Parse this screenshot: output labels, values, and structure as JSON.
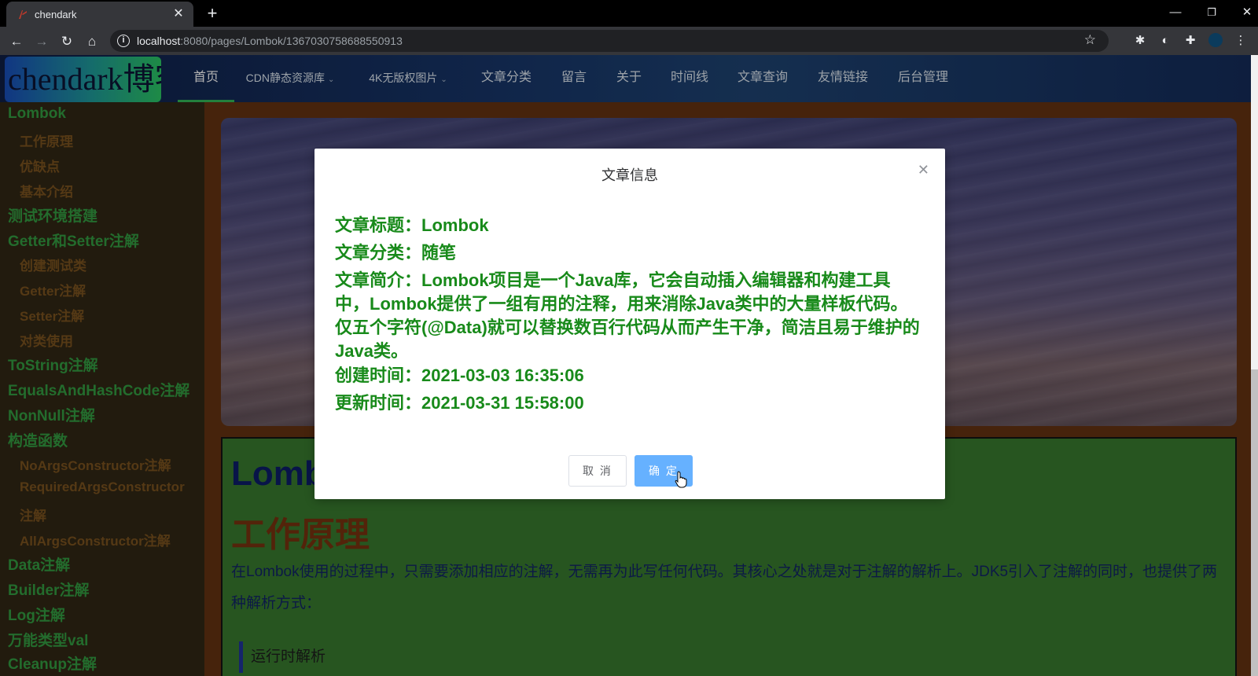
{
  "browser": {
    "tab_title": "chendark",
    "url_host": "localhost",
    "url_rest": ":8080/pages/Lombok/1367030758688550913"
  },
  "header": {
    "logo_text": "chendark博客",
    "menu": [
      {
        "label": "首页",
        "active": true
      },
      {
        "label": "CDN静态资源库",
        "dropdown": true
      },
      {
        "label": "4K无版权图片",
        "dropdown": true
      },
      {
        "label": "文章分类"
      },
      {
        "label": "留言"
      },
      {
        "label": "关于"
      },
      {
        "label": "时间线"
      },
      {
        "label": "文章查询"
      },
      {
        "label": "友情链接"
      },
      {
        "label": "后台管理"
      }
    ]
  },
  "toc": [
    {
      "label": "Lombok",
      "level": 1
    },
    {
      "label": "工作原理",
      "level": 2
    },
    {
      "label": "优缺点",
      "level": 2
    },
    {
      "label": "基本介绍",
      "level": 2
    },
    {
      "label": "测试环境搭建",
      "level": 1
    },
    {
      "label": "Getter和Setter注解",
      "level": 1
    },
    {
      "label": "创建测试类",
      "level": 2
    },
    {
      "label": "Getter注解",
      "level": 2
    },
    {
      "label": "Setter注解",
      "level": 2
    },
    {
      "label": "对类使用",
      "level": 2
    },
    {
      "label": "ToString注解",
      "level": 1
    },
    {
      "label": "EqualsAndHashCode注解",
      "level": 1
    },
    {
      "label": "NonNull注解",
      "level": 1
    },
    {
      "label": "构造函数",
      "level": 1
    },
    {
      "label": "NoArgsConstructor注解",
      "level": 2
    },
    {
      "label": "RequiredArgsConstructor",
      "level": 2
    },
    {
      "label": "注解",
      "level": 2
    },
    {
      "label": "AllArgsConstructor注解",
      "level": 2
    },
    {
      "label": "Data注解",
      "level": 1
    },
    {
      "label": "Builder注解",
      "level": 1
    },
    {
      "label": "Log注解",
      "level": 1
    },
    {
      "label": "万能类型val",
      "level": 1
    },
    {
      "label": "Cleanup注解",
      "level": 1
    }
  ],
  "content": {
    "h1": "Lombok",
    "h2": "工作原理",
    "paragraph": "在Lombok使用的过程中，只需要添加相应的注解，无需再为此写任何代码。其核心之处就是对于注解的解析上。JDK5引入了注解的同时，也提供了两种解析方式：",
    "quote": "运行时解析"
  },
  "dialog": {
    "title": "文章信息",
    "article_title": "文章标题：Lombok",
    "category": "文章分类：随笔",
    "summary": "文章简介：Lombok项目是一个Java库，它会自动插入编辑器和构建工具中，Lombok提供了一组有用的注释，用来消除Java类中的大量样板代码。仅五个字符(@Data)就可以替换数百行代码从而产生干净，简洁且易于维护的Java类。",
    "created": "创建时间：2021-03-03 16:35:06",
    "updated": "更新时间：2021-03-31 15:58:00",
    "cancel_label": "取 消",
    "ok_label": "确 定"
  }
}
